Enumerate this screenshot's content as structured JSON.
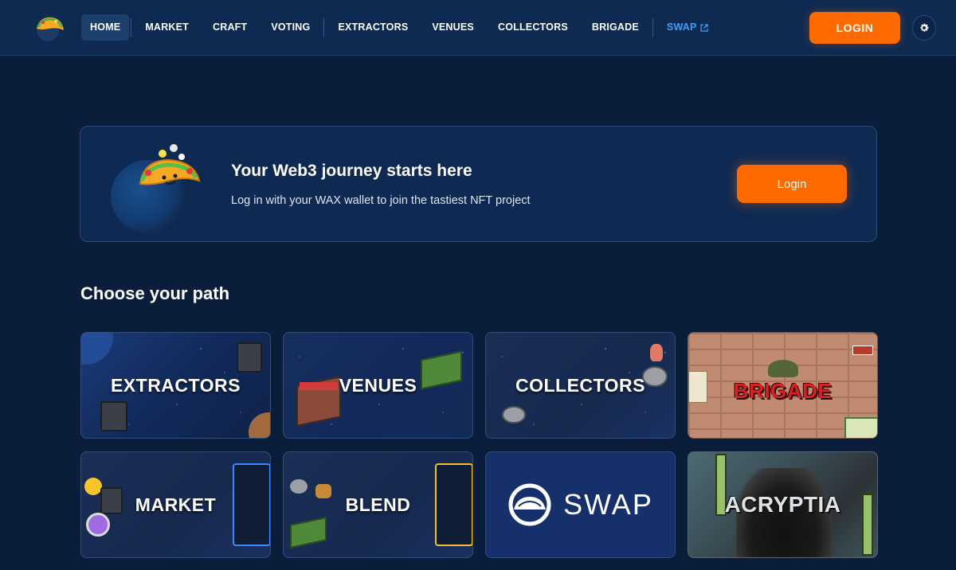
{
  "nav": {
    "logo": "taco-logo",
    "items": [
      {
        "label": "HOME",
        "active": true
      },
      {
        "label": "MARKET"
      },
      {
        "label": "CRAFT"
      },
      {
        "label": "VOTING"
      },
      {
        "label": "EXTRACTORS"
      },
      {
        "label": "VENUES"
      },
      {
        "label": "COLLECTORS"
      },
      {
        "label": "BRIGADE"
      },
      {
        "label": "SWAP",
        "external": true
      }
    ],
    "login_label": "LOGIN",
    "settings_icon": "gear-icon"
  },
  "hero": {
    "title": "Your Web3 journey starts here",
    "subtitle": "Log in with your WAX wallet to join the tastiest NFT project",
    "login_label": "Login"
  },
  "section_title": "Choose your path",
  "cards": [
    {
      "label": "EXTRACTORS"
    },
    {
      "label": "VENUES"
    },
    {
      "label": "COLLECTORS"
    },
    {
      "label": "BRIGADE"
    },
    {
      "label": "MARKET"
    },
    {
      "label": "BLEND"
    },
    {
      "label": "SWAP"
    },
    {
      "label": "ACRYPTIA"
    }
  ],
  "colors": {
    "background": "#0a1e3c",
    "navbar": "#0e2a50",
    "accent_orange": "#ff6a00",
    "swap_blue": "#3aa0ff"
  }
}
